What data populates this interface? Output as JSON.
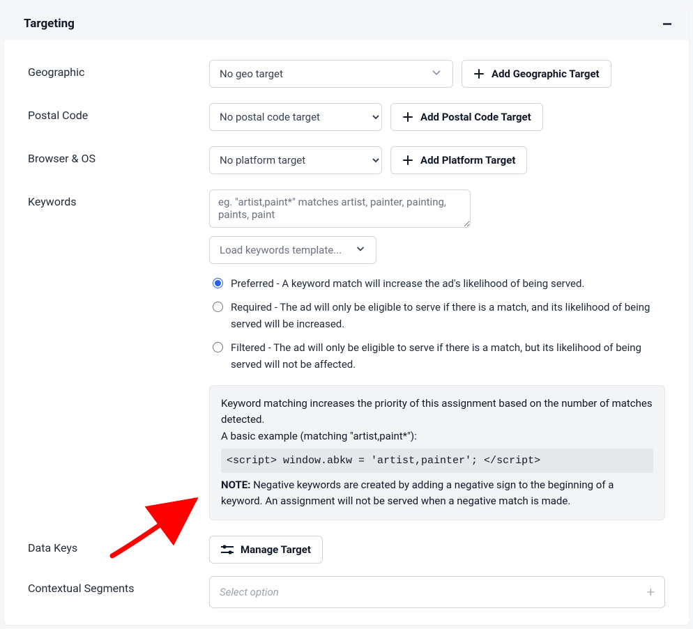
{
  "panel": {
    "title": "Targeting"
  },
  "geo": {
    "label": "Geographic",
    "select_text": "No geo target",
    "add_button": "Add Geographic Target"
  },
  "postal": {
    "label": "Postal Code",
    "select_text": "No postal code target",
    "add_button": "Add Postal Code Target"
  },
  "browser": {
    "label": "Browser & OS",
    "select_text": "No platform target",
    "add_button": "Add Platform Target"
  },
  "keywords": {
    "label": "Keywords",
    "placeholder": "eg. \"artist,paint*\" matches artist, painter, painting, paints, paint",
    "load_template_text": "Load keywords template...",
    "options": {
      "preferred": "Preferred - A keyword match will increase the ad's likelihood of being served.",
      "required": "Required - The ad will only be eligible to serve if there is a match, and its likelihood of being served will be increased.",
      "filtered": "Filtered - The ad will only be eligible to serve if there is a match, but its likelihood of being served will not be affected."
    },
    "info": {
      "line1": "Keyword matching increases the priority of this assignment based on the number of matches detected.",
      "line2": "A basic example (matching \"artist,paint*\"):",
      "code": "<script> window.abkw = 'artist,painter'; </script>",
      "note_label": "NOTE:",
      "note_text": " Negative keywords are created by adding a negative sign to the beginning of a keyword. An assignment will not be served when a negative match is made."
    }
  },
  "datakeys": {
    "label": "Data Keys",
    "button": "Manage Target"
  },
  "segments": {
    "label": "Contextual Segments",
    "placeholder": "Select option"
  }
}
